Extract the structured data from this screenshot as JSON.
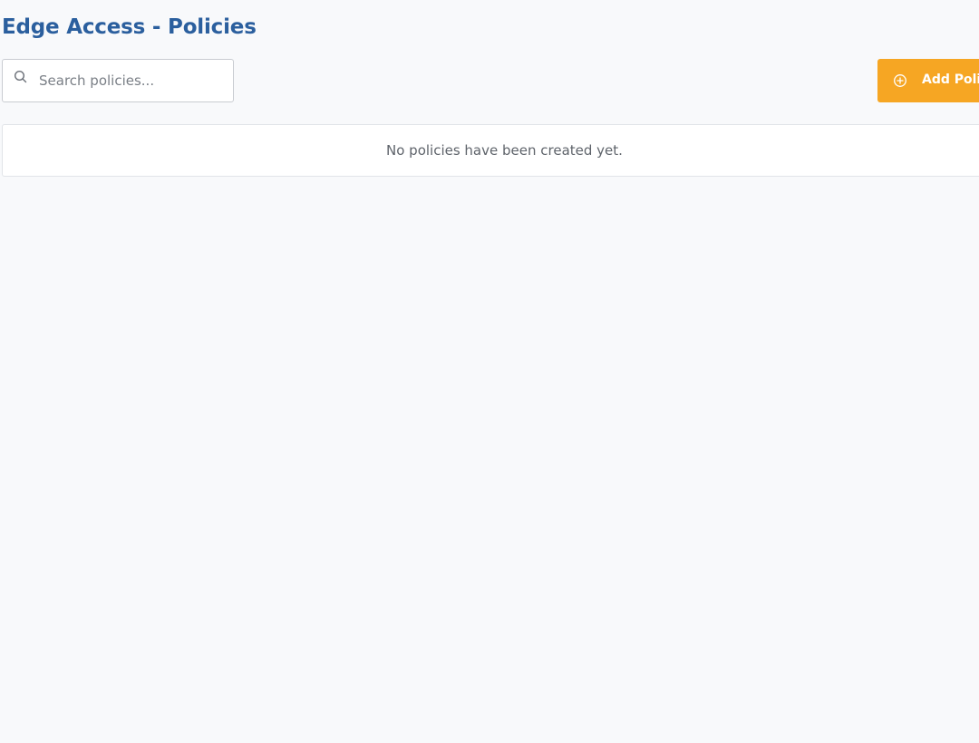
{
  "header": {
    "title": "Edge Access - Policies"
  },
  "search": {
    "placeholder": "Search policies...",
    "value": "",
    "icon": "search-icon"
  },
  "toolbar": {
    "add_label": "Add Policy",
    "add_icon": "plus-circle-icon",
    "accent_color": "#f6a623"
  },
  "policies": {
    "items": [],
    "empty_message": "No policies have been created yet."
  },
  "theme": {
    "title_color": "#2b5f9e",
    "background": "#f8f9fb"
  }
}
